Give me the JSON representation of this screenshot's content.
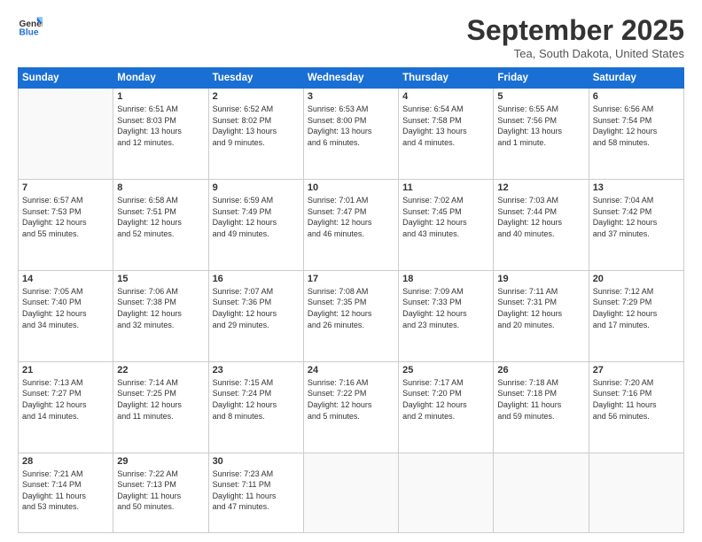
{
  "logo": {
    "line1": "General",
    "line2": "Blue"
  },
  "header": {
    "month": "September 2025",
    "location": "Tea, South Dakota, United States"
  },
  "days": [
    "Sunday",
    "Monday",
    "Tuesday",
    "Wednesday",
    "Thursday",
    "Friday",
    "Saturday"
  ],
  "weeks": [
    [
      {
        "num": "",
        "info": ""
      },
      {
        "num": "1",
        "info": "Sunrise: 6:51 AM\nSunset: 8:03 PM\nDaylight: 13 hours\nand 12 minutes."
      },
      {
        "num": "2",
        "info": "Sunrise: 6:52 AM\nSunset: 8:02 PM\nDaylight: 13 hours\nand 9 minutes."
      },
      {
        "num": "3",
        "info": "Sunrise: 6:53 AM\nSunset: 8:00 PM\nDaylight: 13 hours\nand 6 minutes."
      },
      {
        "num": "4",
        "info": "Sunrise: 6:54 AM\nSunset: 7:58 PM\nDaylight: 13 hours\nand 4 minutes."
      },
      {
        "num": "5",
        "info": "Sunrise: 6:55 AM\nSunset: 7:56 PM\nDaylight: 13 hours\nand 1 minute."
      },
      {
        "num": "6",
        "info": "Sunrise: 6:56 AM\nSunset: 7:54 PM\nDaylight: 12 hours\nand 58 minutes."
      }
    ],
    [
      {
        "num": "7",
        "info": "Sunrise: 6:57 AM\nSunset: 7:53 PM\nDaylight: 12 hours\nand 55 minutes."
      },
      {
        "num": "8",
        "info": "Sunrise: 6:58 AM\nSunset: 7:51 PM\nDaylight: 12 hours\nand 52 minutes."
      },
      {
        "num": "9",
        "info": "Sunrise: 6:59 AM\nSunset: 7:49 PM\nDaylight: 12 hours\nand 49 minutes."
      },
      {
        "num": "10",
        "info": "Sunrise: 7:01 AM\nSunset: 7:47 PM\nDaylight: 12 hours\nand 46 minutes."
      },
      {
        "num": "11",
        "info": "Sunrise: 7:02 AM\nSunset: 7:45 PM\nDaylight: 12 hours\nand 43 minutes."
      },
      {
        "num": "12",
        "info": "Sunrise: 7:03 AM\nSunset: 7:44 PM\nDaylight: 12 hours\nand 40 minutes."
      },
      {
        "num": "13",
        "info": "Sunrise: 7:04 AM\nSunset: 7:42 PM\nDaylight: 12 hours\nand 37 minutes."
      }
    ],
    [
      {
        "num": "14",
        "info": "Sunrise: 7:05 AM\nSunset: 7:40 PM\nDaylight: 12 hours\nand 34 minutes."
      },
      {
        "num": "15",
        "info": "Sunrise: 7:06 AM\nSunset: 7:38 PM\nDaylight: 12 hours\nand 32 minutes."
      },
      {
        "num": "16",
        "info": "Sunrise: 7:07 AM\nSunset: 7:36 PM\nDaylight: 12 hours\nand 29 minutes."
      },
      {
        "num": "17",
        "info": "Sunrise: 7:08 AM\nSunset: 7:35 PM\nDaylight: 12 hours\nand 26 minutes."
      },
      {
        "num": "18",
        "info": "Sunrise: 7:09 AM\nSunset: 7:33 PM\nDaylight: 12 hours\nand 23 minutes."
      },
      {
        "num": "19",
        "info": "Sunrise: 7:11 AM\nSunset: 7:31 PM\nDaylight: 12 hours\nand 20 minutes."
      },
      {
        "num": "20",
        "info": "Sunrise: 7:12 AM\nSunset: 7:29 PM\nDaylight: 12 hours\nand 17 minutes."
      }
    ],
    [
      {
        "num": "21",
        "info": "Sunrise: 7:13 AM\nSunset: 7:27 PM\nDaylight: 12 hours\nand 14 minutes."
      },
      {
        "num": "22",
        "info": "Sunrise: 7:14 AM\nSunset: 7:25 PM\nDaylight: 12 hours\nand 11 minutes."
      },
      {
        "num": "23",
        "info": "Sunrise: 7:15 AM\nSunset: 7:24 PM\nDaylight: 12 hours\nand 8 minutes."
      },
      {
        "num": "24",
        "info": "Sunrise: 7:16 AM\nSunset: 7:22 PM\nDaylight: 12 hours\nand 5 minutes."
      },
      {
        "num": "25",
        "info": "Sunrise: 7:17 AM\nSunset: 7:20 PM\nDaylight: 12 hours\nand 2 minutes."
      },
      {
        "num": "26",
        "info": "Sunrise: 7:18 AM\nSunset: 7:18 PM\nDaylight: 11 hours\nand 59 minutes."
      },
      {
        "num": "27",
        "info": "Sunrise: 7:20 AM\nSunset: 7:16 PM\nDaylight: 11 hours\nand 56 minutes."
      }
    ],
    [
      {
        "num": "28",
        "info": "Sunrise: 7:21 AM\nSunset: 7:14 PM\nDaylight: 11 hours\nand 53 minutes."
      },
      {
        "num": "29",
        "info": "Sunrise: 7:22 AM\nSunset: 7:13 PM\nDaylight: 11 hours\nand 50 minutes."
      },
      {
        "num": "30",
        "info": "Sunrise: 7:23 AM\nSunset: 7:11 PM\nDaylight: 11 hours\nand 47 minutes."
      },
      {
        "num": "",
        "info": ""
      },
      {
        "num": "",
        "info": ""
      },
      {
        "num": "",
        "info": ""
      },
      {
        "num": "",
        "info": ""
      }
    ]
  ]
}
